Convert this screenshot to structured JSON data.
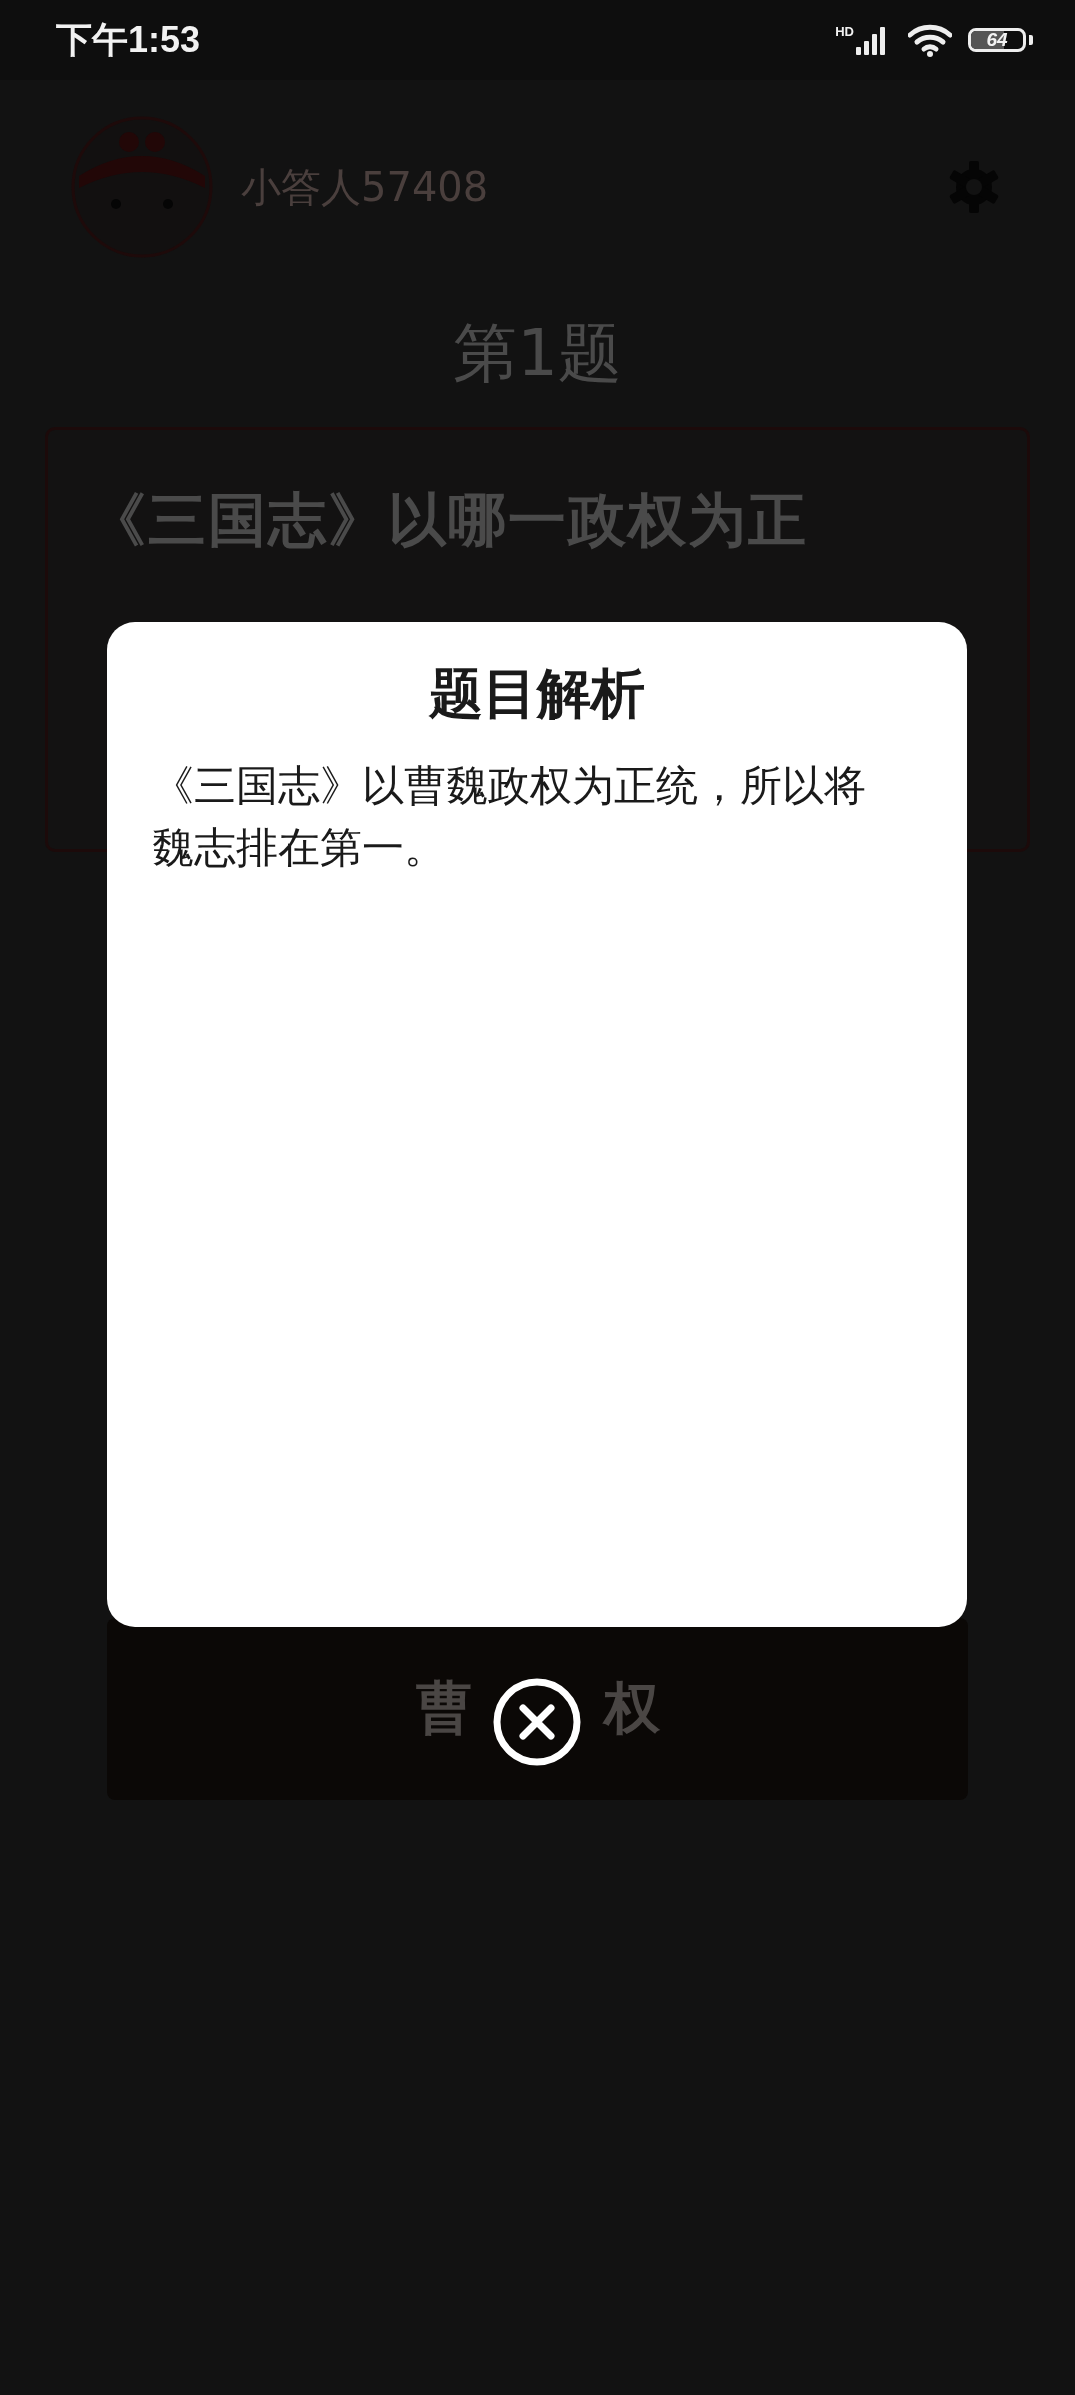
{
  "status_bar": {
    "time": "下午1:53",
    "network": "HD",
    "battery": "64"
  },
  "header": {
    "username": "小答人57408"
  },
  "question": {
    "number": "第1题",
    "text": "《三国志》以哪一政权为正"
  },
  "answer_button": {
    "label_start": "曹",
    "label_end": "权"
  },
  "dialog": {
    "title": "题目解析",
    "body": "《三国志》以曹魏政权为正统，所以将魏志排在第一。"
  }
}
